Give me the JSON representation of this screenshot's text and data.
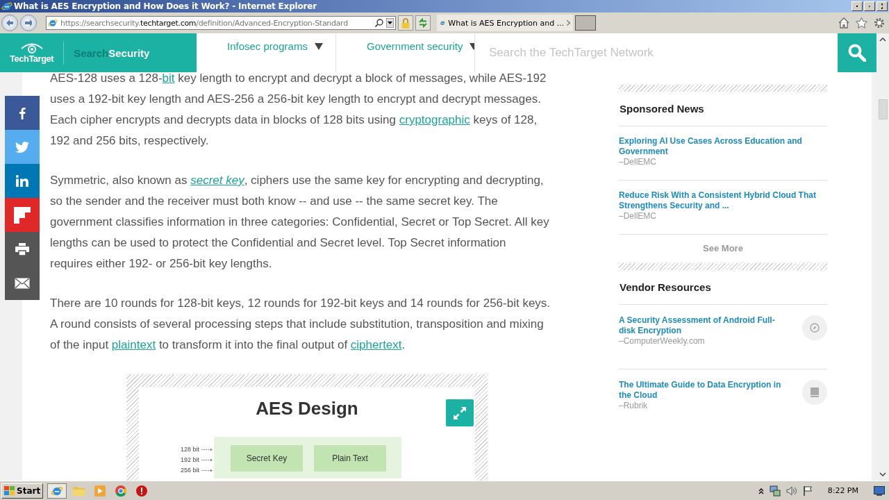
{
  "browser": {
    "window_title": "What is AES Encryption and How Does it Work? - Internet Explorer",
    "address": {
      "scheme": "https://",
      "subdomain": "searchsecurity.",
      "domain": "techtarget.com",
      "path": "/definition/Advanced-Encryption-Standard"
    },
    "tabs": [
      {
        "title": "What is AES Encryption and ...",
        "selected": true
      }
    ]
  },
  "site_header": {
    "logo": "TechTarget",
    "brand_prefix": "Search",
    "brand_name": "Security",
    "nav": [
      {
        "label": "Infosec programs"
      },
      {
        "label": "Government security"
      }
    ],
    "search_placeholder": "Search the TechTarget Network"
  },
  "article": {
    "paragraphs": [
      {
        "parts": [
          {
            "kind": "text",
            "text": "AES-128 uses a 128-"
          },
          {
            "kind": "link",
            "text": "bit"
          },
          {
            "kind": "text",
            "text": " key length to encrypt and decrypt a block of messages, while AES-192 uses a 192-bit key length and AES-256 a 256-bit key length to encrypt and decrypt messages. Each cipher encrypts and decrypts data in blocks of 128 bits using "
          },
          {
            "kind": "link",
            "text": "cryptographic"
          },
          {
            "kind": "text",
            "text": " keys of 128, 192 and 256 bits, respectively."
          }
        ]
      },
      {
        "parts": [
          {
            "kind": "text",
            "text": "Symmetric, also known as "
          },
          {
            "kind": "link",
            "text": "secret key",
            "italic": true
          },
          {
            "kind": "text",
            "text": ", ciphers use the same key for encrypting and decrypting, so the sender and the receiver must both know -- and use -- the same secret key. The government classifies information in three categories: Confidential, Secret or Top Secret. All key lengths can be used to protect the Confidential and Secret level. Top Secret information requires either 192- or 256-bit key lengths."
          }
        ]
      },
      {
        "parts": [
          {
            "kind": "text",
            "text": "There are 10 rounds for 128-bit keys, 12 rounds for 192-bit keys and 14 rounds for 256-bit keys. A round consists of several processing steps that include substitution, transposition and mixing of the input "
          },
          {
            "kind": "link",
            "text": "plaintext"
          },
          {
            "kind": "text",
            "text": " to transform it into the final output of "
          },
          {
            "kind": "link",
            "text": "ciphertext"
          },
          {
            "kind": "text",
            "text": "."
          }
        ]
      }
    ],
    "figure": {
      "title": "AES Design",
      "key_sizes": [
        "128 bit",
        "192 bit",
        "256 bit"
      ],
      "boxes": [
        "Secret Key",
        "Plain Text"
      ]
    }
  },
  "share_bar": [
    {
      "kind": "facebook"
    },
    {
      "kind": "twitter"
    },
    {
      "kind": "linkedin"
    },
    {
      "kind": "flipboard"
    },
    {
      "kind": "print"
    },
    {
      "kind": "email"
    }
  ],
  "sidebar": {
    "sponsored_news": {
      "heading": "Sponsored News",
      "items": [
        {
          "title": "Exploring AI Use Cases Across Education and Government",
          "source": "–DellEMC"
        },
        {
          "title": "Reduce Risk With a Consistent Hybrid Cloud That Strengthens Security and ...",
          "source": "–DellEMC"
        }
      ],
      "see_more": "See More"
    },
    "vendor_resources": {
      "heading": "Vendor Resources",
      "items": [
        {
          "title": "A Security Assessment of Android Full-disk Encryption",
          "source": "–ComputerWeekly.com",
          "kind": "compass"
        },
        {
          "title": "The Ultimate Guide to Data Encryption in the Cloud",
          "source": "–Rubrik",
          "kind": "book"
        }
      ]
    }
  },
  "taskbar": {
    "start": "Start",
    "clock": "8:22 PM"
  }
}
